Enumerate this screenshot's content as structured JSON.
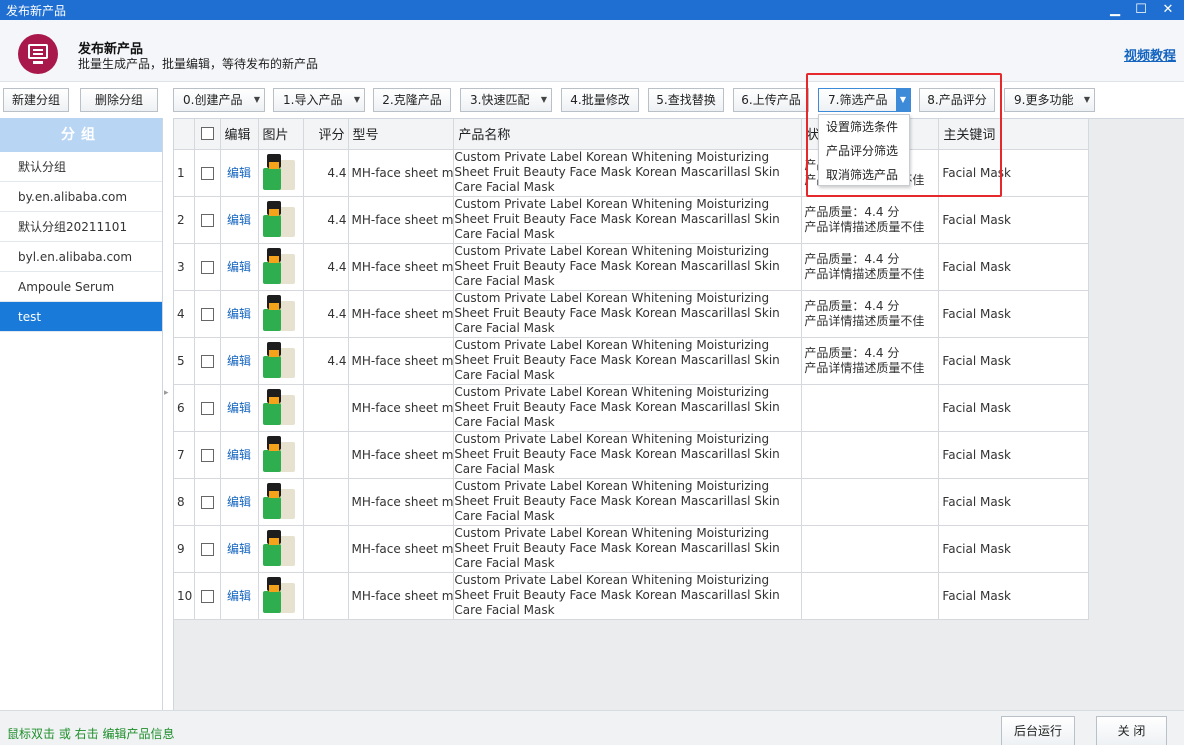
{
  "window": {
    "title": "发布新产品",
    "min_glyph": "▁",
    "max_glyph": "☐",
    "close_glyph": "✕"
  },
  "header": {
    "title": "发布新产品",
    "subtitle": "批量生成产品，批量编辑，等待发布的新产品",
    "video_link": "视频教程",
    "icon": "monitor-icon"
  },
  "sidebar": {
    "new_group": "新建分组",
    "delete_group": "删除分组",
    "group_header": "分组",
    "items": [
      {
        "label": "默认分组",
        "active": false
      },
      {
        "label": "by.en.alibaba.com",
        "active": false
      },
      {
        "label": "默认分组20211101",
        "active": false
      },
      {
        "label": "byl.en.alibaba.com",
        "active": false
      },
      {
        "label": "Ampoule Serum",
        "active": false
      },
      {
        "label": "test",
        "active": true
      }
    ]
  },
  "toolbar": {
    "create": "0.创建产品",
    "import": "1.导入产品",
    "clone": "2.克隆产品",
    "quick_match": "3.快速匹配",
    "batch_edit": "4.批量修改",
    "find_replace": "5.查找替换",
    "upload": "6.上传产品",
    "filter": "7.筛选产品",
    "rate": "8.产品评分",
    "more": "9.更多功能"
  },
  "filter_menu": {
    "items": [
      "设置筛选条件",
      "产品评分筛选",
      "取消筛选产品"
    ]
  },
  "grid": {
    "columns": {
      "edit": "编辑",
      "image": "图片",
      "rating": "评分",
      "model": "型号",
      "name": "产品名称",
      "status": "状",
      "keyword": "主关键词"
    },
    "edit_label": "编辑",
    "rows": [
      {
        "num": "1",
        "rating": "4.4",
        "model": "MH-face sheet m",
        "name": "Custom Private Label Korean Whitening Moisturizing Sheet Fruit Beauty Face Mask Korean Mascarillasl Skin Care Facial Mask",
        "status1": "产品质量：4.4 分",
        "status2": "产品详情描述质量不佳",
        "keyword": "Facial Mask"
      },
      {
        "num": "2",
        "rating": "4.4",
        "model": "MH-face sheet m",
        "name": "Custom Private Label Korean Whitening Moisturizing Sheet Fruit Beauty Face Mask Korean Mascarillasl Skin Care Facial Mask",
        "status1": "产品质量：4.4 分",
        "status2": "产品详情描述质量不佳",
        "keyword": "Facial Mask"
      },
      {
        "num": "3",
        "rating": "4.4",
        "model": "MH-face sheet m",
        "name": "Custom Private Label Korean Whitening Moisturizing Sheet Fruit Beauty Face Mask Korean Mascarillasl Skin Care Facial Mask",
        "status1": "产品质量：4.4 分",
        "status2": "产品详情描述质量不佳",
        "keyword": "Facial Mask"
      },
      {
        "num": "4",
        "rating": "4.4",
        "model": "MH-face sheet m",
        "name": "Custom Private Label Korean Whitening Moisturizing Sheet Fruit Beauty Face Mask Korean Mascarillasl Skin Care Facial Mask",
        "status1": "产品质量：4.4 分",
        "status2": "产品详情描述质量不佳",
        "keyword": "Facial Mask"
      },
      {
        "num": "5",
        "rating": "4.4",
        "model": "MH-face sheet m",
        "name": "Custom Private Label Korean Whitening Moisturizing Sheet Fruit Beauty Face Mask Korean Mascarillasl Skin Care Facial Mask",
        "status1": "产品质量：4.4 分",
        "status2": "产品详情描述质量不佳",
        "keyword": "Facial Mask"
      },
      {
        "num": "6",
        "rating": "",
        "model": "MH-face sheet m",
        "name": "Custom Private Label Korean Whitening Moisturizing Sheet Fruit Beauty Face Mask Korean Mascarillasl Skin Care Facial Mask",
        "status1": "",
        "status2": "",
        "keyword": "Facial Mask"
      },
      {
        "num": "7",
        "rating": "",
        "model": "MH-face sheet m",
        "name": "Custom Private Label Korean Whitening Moisturizing Sheet Fruit Beauty Face Mask Korean Mascarillasl Skin Care Facial Mask",
        "status1": "",
        "status2": "",
        "keyword": "Facial Mask"
      },
      {
        "num": "8",
        "rating": "",
        "model": "MH-face sheet m",
        "name": "Custom Private Label Korean Whitening Moisturizing Sheet Fruit Beauty Face Mask Korean Mascarillasl Skin Care Facial Mask",
        "status1": "",
        "status2": "",
        "keyword": "Facial Mask"
      },
      {
        "num": "9",
        "rating": "",
        "model": "MH-face sheet m",
        "name": "Custom Private Label Korean Whitening Moisturizing Sheet Fruit Beauty Face Mask Korean Mascarillasl Skin Care Facial Mask",
        "status1": "",
        "status2": "",
        "keyword": "Facial Mask"
      },
      {
        "num": "10",
        "rating": "",
        "model": "MH-face sheet m",
        "name": "Custom Private Label Korean Whitening Moisturizing Sheet Fruit Beauty Face Mask Korean Mascarillasl Skin Care Facial Mask",
        "status1": "",
        "status2": "",
        "keyword": "Facial Mask"
      }
    ]
  },
  "footer": {
    "hint": "鼠标双击 或 右击 编辑产品信息",
    "background_run": "后台运行",
    "close": "关 闭"
  },
  "colors": {
    "titlebar": "#1f6fd3",
    "accent": "#1a7ad9",
    "highlight": "#e5282c",
    "hint": "#1f8f2c"
  }
}
